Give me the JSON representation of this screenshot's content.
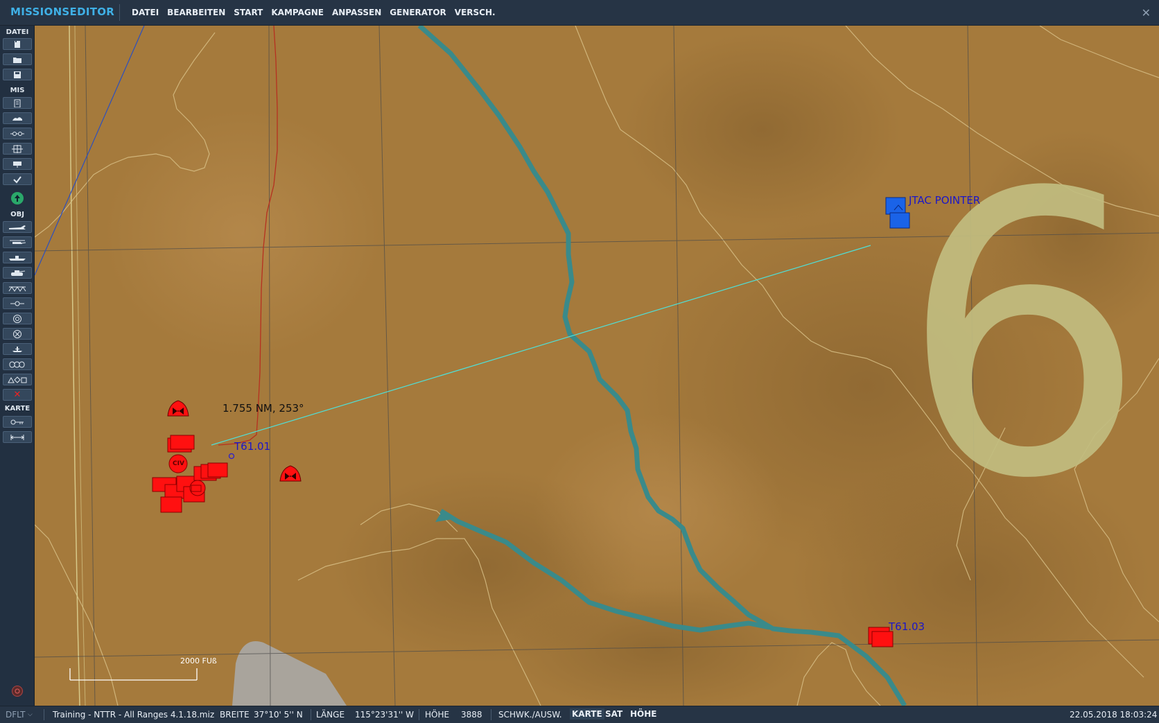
{
  "app": {
    "title": "MISSIONSEDITOR"
  },
  "menu": [
    "DATEI",
    "BEARBEITEN",
    "START",
    "KAMPAGNE",
    "ANPASSEN",
    "GENERATOR",
    "VERSCH."
  ],
  "window": {
    "close_glyph": "✕"
  },
  "sidebar": {
    "sections": [
      "DATEI",
      "MIS",
      "OBJ",
      "KARTE"
    ],
    "delete_glyph": "✕"
  },
  "map": {
    "units": [
      {
        "label": "T61.01",
        "coalition": "red"
      },
      {
        "label": "JTAC POINTER",
        "coalition": "blue"
      },
      {
        "label": "T61.03",
        "coalition": "red"
      },
      {
        "label": "CIV",
        "coalition": "red"
      }
    ],
    "measure": "1.755 NM, 253°",
    "grid_label": "6",
    "scale": "2000 FUß",
    "colors": {
      "terrain": "#a57a3c",
      "river": "#3a8a8a",
      "red_unit": "#ff1010",
      "blue_unit": "#1a63e8",
      "measure_line": "#4fe0d8"
    }
  },
  "status": {
    "profile": "DFLT",
    "file": "Training - NTTR - All Ranges 4.1.18.miz",
    "lat_label": "BREITE",
    "lat_value": "37°10' 5'' N",
    "lon_label": "LÄNGE",
    "lon_value": "115°23'31'' W",
    "alt_label": "HÖHE",
    "alt_value": "3888",
    "filter_label": "SCHWK./AUSW.",
    "map_modes": [
      "KARTE",
      "SAT",
      "HÖHE"
    ],
    "datetime": "22.05.2018 18:03:24"
  }
}
